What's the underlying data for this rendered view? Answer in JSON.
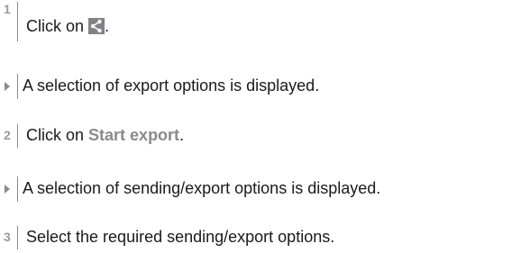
{
  "steps": [
    {
      "number": "1",
      "prefix": "Click on ",
      "icon": "share-icon",
      "suffix": "."
    },
    {
      "number": "2",
      "prefix": "Click on ",
      "emphasis": "Start export",
      "suffix": "."
    },
    {
      "number": "3",
      "text": "Select the required sending/export options."
    }
  ],
  "results": [
    "A selection of export options is displayed.",
    "A selection of sending/export options is displayed."
  ],
  "colors": {
    "step_number": "#9a9a9a",
    "emphasis": "#8a8a8a",
    "divider": "#8c8c8c",
    "icon_background": "#7f8387"
  }
}
